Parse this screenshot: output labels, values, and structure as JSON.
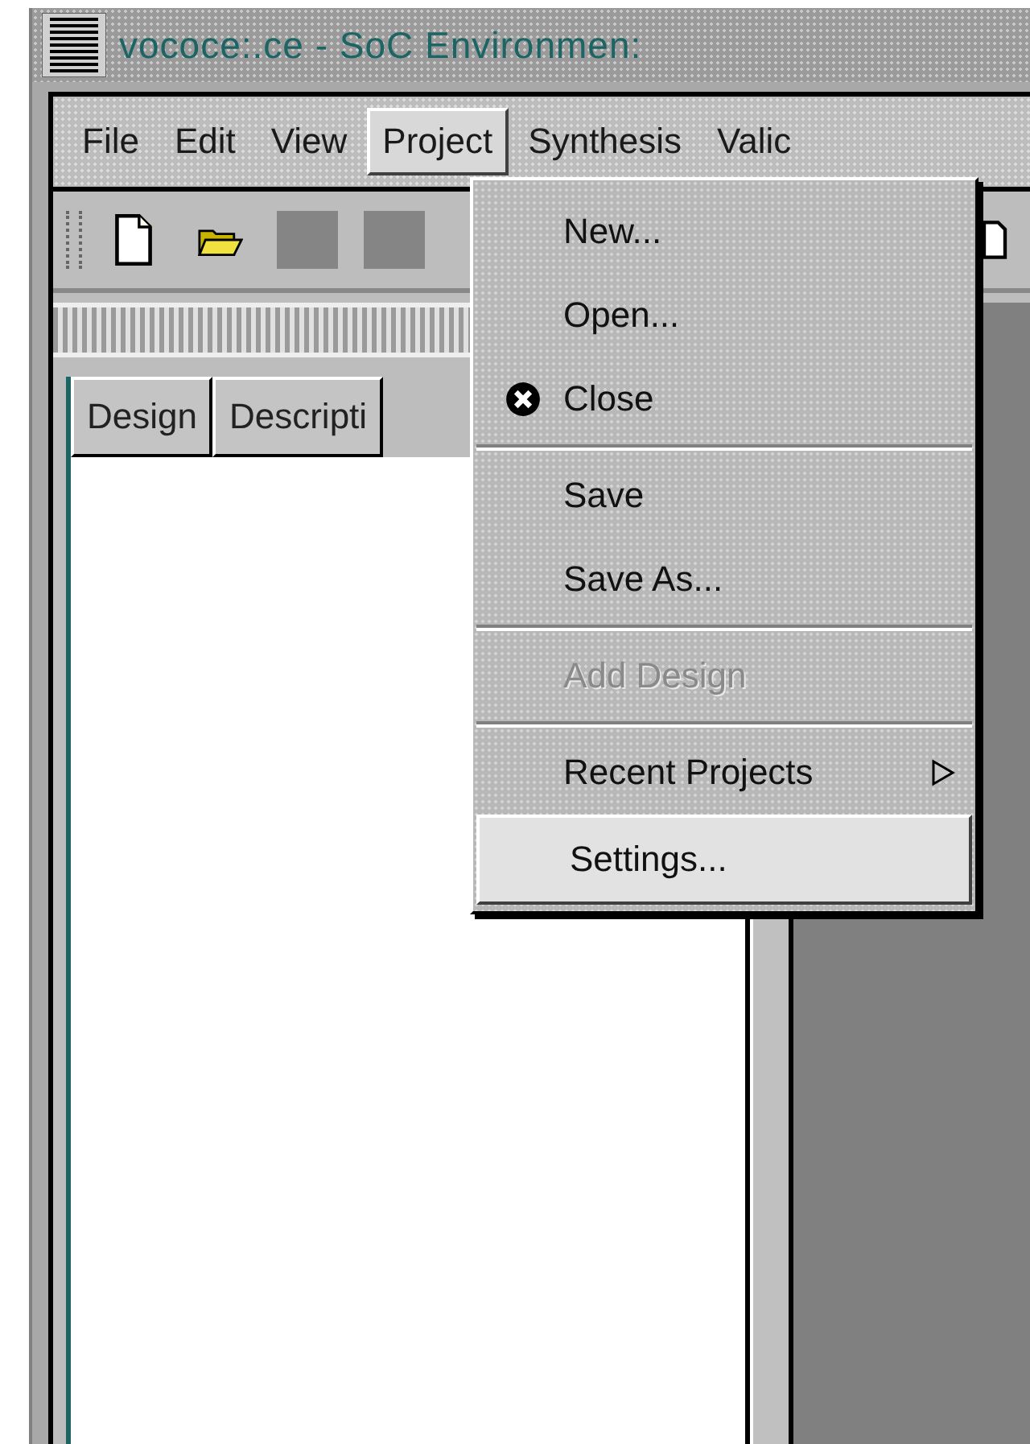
{
  "window": {
    "title": "vococe:.ce - SoC Environmen:"
  },
  "menubar": [
    {
      "label": "File",
      "selected": false
    },
    {
      "label": "Edit",
      "selected": false
    },
    {
      "label": "View",
      "selected": false
    },
    {
      "label": "Project",
      "selected": true
    },
    {
      "label": "Synthesis",
      "selected": false
    },
    {
      "label": "Valic",
      "selected": false
    }
  ],
  "toolbar": [
    {
      "kind": "new"
    },
    {
      "kind": "open"
    },
    {
      "kind": "blank"
    },
    {
      "kind": "blank"
    },
    {
      "kind": "doc"
    }
  ],
  "list": {
    "columns": [
      "Design",
      "Descripti"
    ]
  },
  "menu": {
    "items": [
      {
        "kind": "item",
        "label": "New...",
        "disabled": false,
        "selected": false
      },
      {
        "kind": "item",
        "label": "Open...",
        "disabled": false,
        "selected": false
      },
      {
        "kind": "icon_item",
        "label": "Close",
        "disabled": false,
        "selected": false
      },
      {
        "kind": "separator"
      },
      {
        "kind": "item",
        "label": "Save",
        "disabled": false,
        "selected": false
      },
      {
        "kind": "item",
        "label": "Save As...",
        "disabled": false,
        "selected": false
      },
      {
        "kind": "separator"
      },
      {
        "kind": "item",
        "label": "Add Design",
        "disabled": true,
        "selected": false
      },
      {
        "kind": "separator"
      },
      {
        "kind": "submenu",
        "label": "Recent Projects",
        "disabled": false,
        "selected": false
      },
      {
        "kind": "item",
        "label": "Settings...",
        "disabled": false,
        "selected": true
      }
    ]
  }
}
